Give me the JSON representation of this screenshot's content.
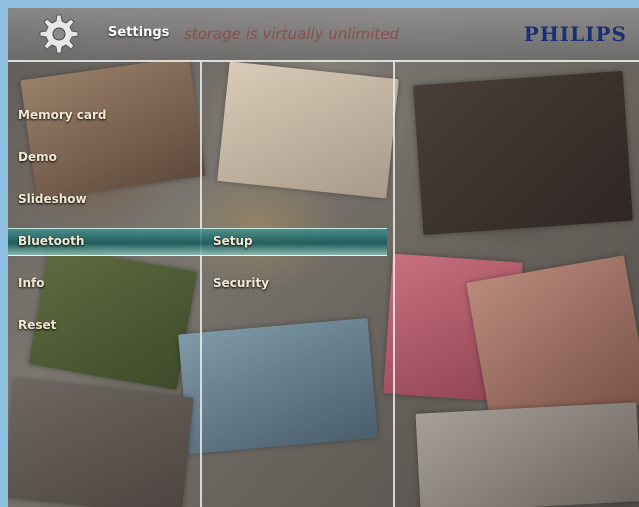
{
  "header": {
    "title": "Settings",
    "ghost_text": "storage is virtually unlimited",
    "brand": "PHILIPS"
  },
  "menu_col1": [
    {
      "label": "Memory card"
    },
    {
      "label": "Demo"
    },
    {
      "label": "Slideshow"
    },
    {
      "label": "Bluetooth",
      "selected": true
    },
    {
      "label": "Info"
    },
    {
      "label": "Reset"
    }
  ],
  "menu_col2": [
    {
      "label": "Setup"
    },
    {
      "label": "Security"
    }
  ],
  "icons": {
    "settings": "gear-icon"
  },
  "colors": {
    "highlight": "#2c8c8c",
    "brand": "#1a2f78",
    "menu_text": "#f3e9d2",
    "frame_border": "#8fc0e2"
  }
}
